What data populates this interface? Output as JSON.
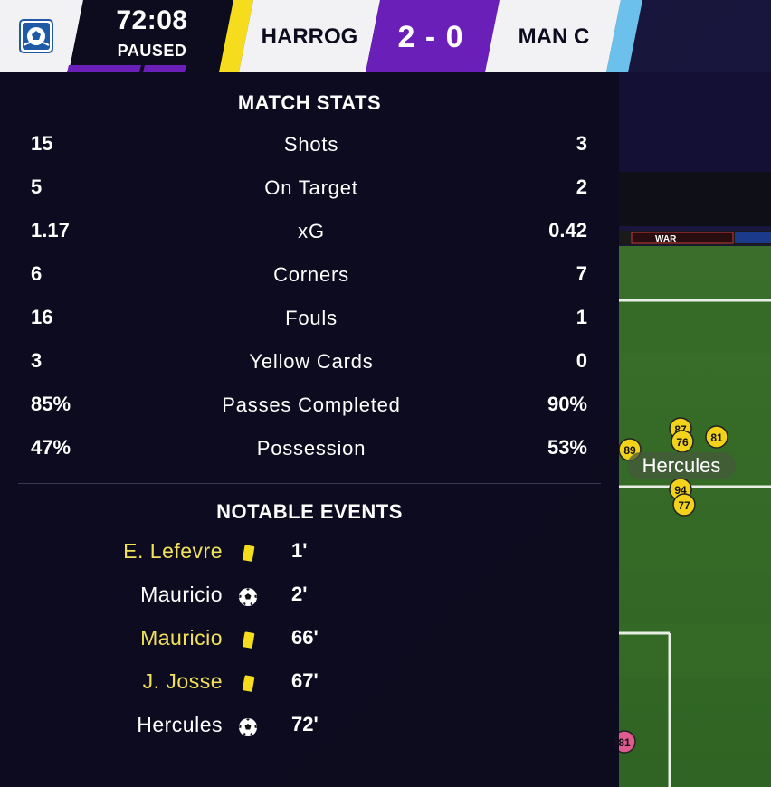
{
  "colors": {
    "accent_purple": "#6a1fb8",
    "home_yellow": "#f5dd1d",
    "away_blue": "#6cc1ec",
    "card_yellow": "#f5dd1d",
    "panel_bg": "#0d0b1e"
  },
  "scoreboard": {
    "club_icon": "club-crest-icon",
    "time": "72:08",
    "state": "PAUSED",
    "home_team": "HARROG",
    "score": "2 - 0",
    "away_team": "MAN C"
  },
  "stats": {
    "title": "MATCH STATS",
    "rows": [
      {
        "home": "15",
        "label": "Shots",
        "away": "3"
      },
      {
        "home": "5",
        "label": "On Target",
        "away": "2"
      },
      {
        "home": "1.17",
        "label": "xG",
        "away": "0.42"
      },
      {
        "home": "6",
        "label": "Corners",
        "away": "7"
      },
      {
        "home": "16",
        "label": "Fouls",
        "away": "1"
      },
      {
        "home": "3",
        "label": "Yellow Cards",
        "away": "0"
      },
      {
        "home": "85%",
        "label": "Passes Completed",
        "away": "90%"
      },
      {
        "home": "47%",
        "label": "Possession",
        "away": "53%"
      }
    ]
  },
  "events": {
    "title": "NOTABLE EVENTS",
    "items": [
      {
        "player": "E. Lefevre",
        "type": "yellow-card-icon",
        "minute": "1'"
      },
      {
        "player": "Mauricio",
        "type": "goal-ball-icon",
        "minute": "2'"
      },
      {
        "player": "Mauricio",
        "type": "yellow-card-icon",
        "minute": "66'"
      },
      {
        "player": "J. Josse",
        "type": "yellow-card-icon",
        "minute": "67'"
      },
      {
        "player": "Hercules",
        "type": "goal-ball-icon",
        "minute": "72'"
      }
    ]
  },
  "pitch": {
    "tooltip_player": "Hercules",
    "ad_board_text": "WAR",
    "player_numbers": [
      "87",
      "81",
      "89",
      "76",
      "94",
      "77",
      "81"
    ]
  }
}
